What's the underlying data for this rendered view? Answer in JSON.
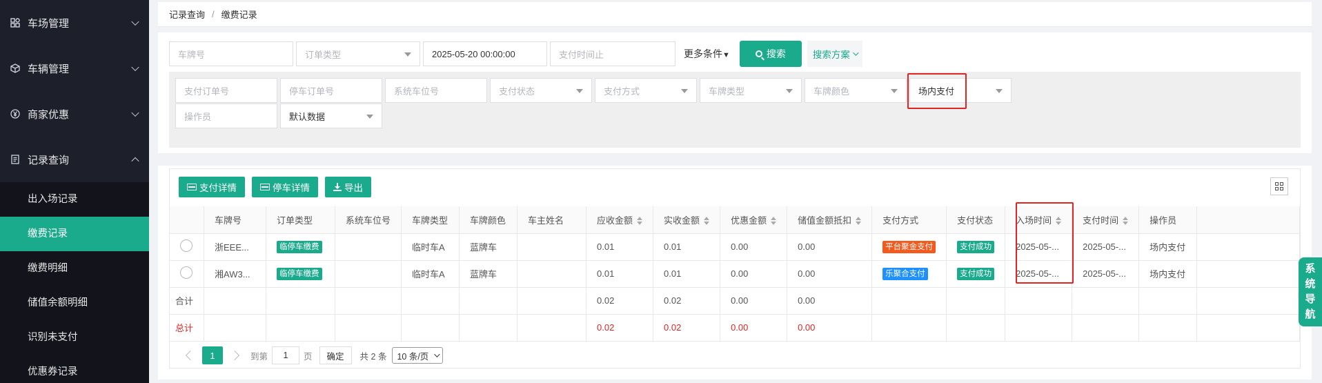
{
  "sidebar": {
    "groups": [
      {
        "label": "车场管理",
        "icon": "lot-icon"
      },
      {
        "label": "车辆管理",
        "icon": "car-icon"
      },
      {
        "label": "商家优惠",
        "icon": "yen-icon"
      },
      {
        "label": "记录查询",
        "icon": "record-icon"
      }
    ],
    "sub_items": [
      "出入场记录",
      "缴费记录",
      "缴费明细",
      "储值余额明细",
      "识别未支付",
      "优惠券记录"
    ]
  },
  "breadcrumb": {
    "root": "记录查询",
    "sep": "/",
    "current": "缴费记录"
  },
  "search": {
    "plate_placeholder": "车牌号",
    "order_type_placeholder": "订单类型",
    "pay_time_start": "2025-05-20 00:00:00",
    "pay_time_end_placeholder": "支付时间止",
    "more_label": "更多条件",
    "search_button": "搜索",
    "plan_label": "搜索方案"
  },
  "more_filters": {
    "pay_order_no": "支付订单号",
    "park_order_no": "停车订单号",
    "system_slot": "系统车位号",
    "pay_status": "支付状态",
    "pay_method": "支付方式",
    "plate_type": "车牌类型",
    "plate_color": "车牌颜色",
    "pay_scene_value": "场内支付",
    "operator": "操作员",
    "data_scope_value": "默认数据"
  },
  "toolbar": {
    "pay_detail": "支付详情",
    "park_detail": "停车详情",
    "export": "导出"
  },
  "table": {
    "headers": [
      "车牌号",
      "订单类型",
      "系统车位号",
      "车牌类型",
      "车牌颜色",
      "车主姓名",
      "应收金额",
      "实收金额",
      "优惠金额",
      "储值金额抵扣",
      "支付方式",
      "支付状态",
      "入场时间",
      "支付时间",
      "操作员"
    ],
    "rows": [
      {
        "plate": "浙EEE...",
        "order_type": "临停车缴费",
        "slot": "",
        "plate_type": "临时车A",
        "plate_color": "蓝牌车",
        "owner": "",
        "receivable": "0.01",
        "received": "0.01",
        "discount": "0.00",
        "stored": "0.00",
        "pay_method": "平台聚金支付",
        "pay_method_color": "orange",
        "pay_status": "支付成功",
        "enter_time": "2025-05-...",
        "pay_time": "2025-05-...",
        "operator": "场内支付"
      },
      {
        "plate": "湘AW3...",
        "order_type": "临停车缴费",
        "slot": "",
        "plate_type": "临时车A",
        "plate_color": "蓝牌车",
        "owner": "",
        "receivable": "0.01",
        "received": "0.01",
        "discount": "0.00",
        "stored": "0.00",
        "pay_method": "乐聚合支付",
        "pay_method_color": "blue",
        "pay_status": "支付成功",
        "enter_time": "2025-05-...",
        "pay_time": "2025-05-...",
        "operator": "场内支付"
      }
    ],
    "subtotal": {
      "label": "合计",
      "receivable": "0.02",
      "received": "0.02",
      "discount": "0.00",
      "stored": "0.00"
    },
    "total": {
      "label": "总计",
      "receivable": "0.02",
      "received": "0.02",
      "discount": "0.00",
      "stored": "0.00"
    }
  },
  "pager": {
    "current": "1",
    "goto_label": "到第",
    "goto_value": "1",
    "page_label": "页",
    "confirm": "确定",
    "total": "共 2 条",
    "page_size": "10 条/页"
  },
  "sys_nav": [
    "系",
    "统",
    "导",
    "航"
  ],
  "colors": {
    "accent": "#1aaa8c",
    "sidebar": "#1d1f2a",
    "highlight": "#e02424"
  }
}
